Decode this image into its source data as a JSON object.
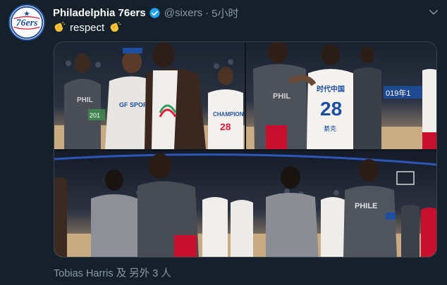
{
  "tweet": {
    "display_name": "Philadelphia 76ers",
    "handle": "@sixers",
    "separator": "·",
    "time": "5小时",
    "text": "respect",
    "avatar_text": "76ers",
    "verified_icon": "verified-badge-icon",
    "caret_icon": "chevron-down-icon",
    "emoji_left": "clapping-hands-icon",
    "emoji_right": "clapping-hands-icon",
    "tagged_users": "Tobias Harris 及 另外 3 人"
  },
  "media": {
    "photos": [
      {
        "jerseys": [
          "28"
        ],
        "shirt_text": [
          "PHIL",
          "GF SPORTS",
          "CHAMPIONS",
          "201"
        ]
      },
      {
        "jerseys": [
          "28"
        ],
        "shirt_text": [
          "PHIL",
          "时代中国",
          "綦克",
          "019年1"
        ]
      },
      {
        "jerseys": [],
        "shirt_text": [
          "PHILE"
        ]
      }
    ]
  },
  "colors": {
    "background": "#15202b",
    "secondary_text": "#8899a6",
    "verified": "#1da1f2",
    "brand_blue": "#1d4ea0",
    "brand_red": "#e01e3c"
  }
}
